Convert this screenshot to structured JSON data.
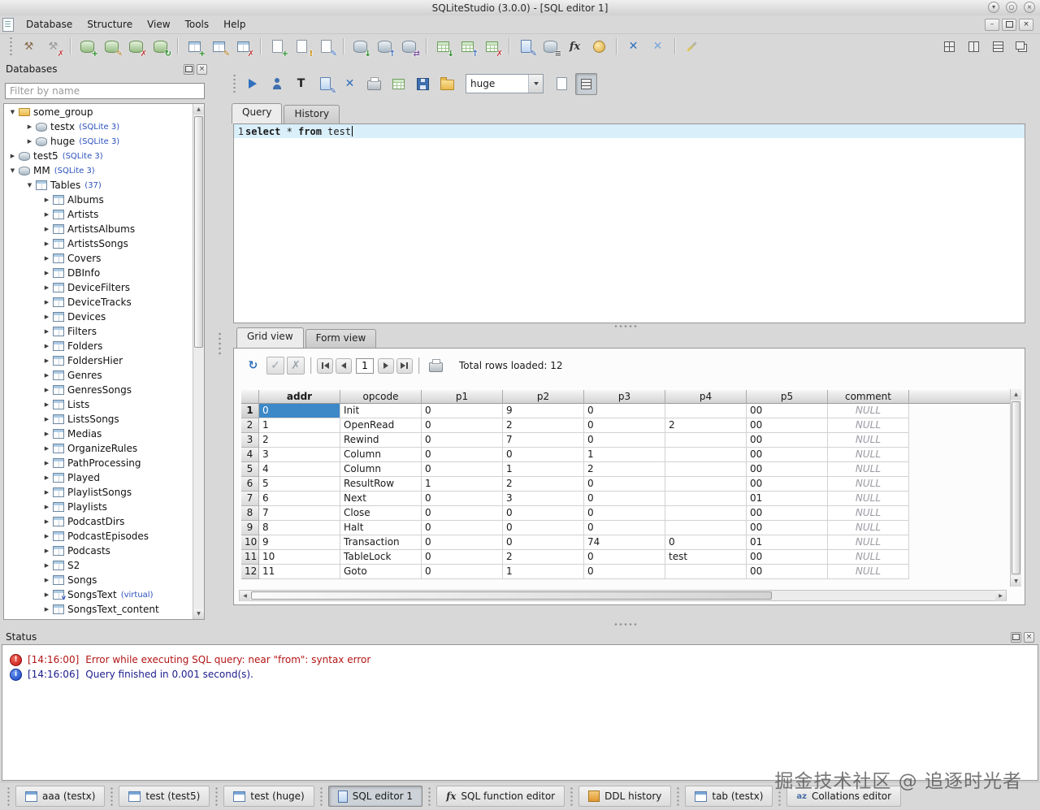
{
  "window": {
    "title": "SQLiteStudio (3.0.0) - [SQL editor 1]"
  },
  "menubar": {
    "items": [
      "Database",
      "Structure",
      "View",
      "Tools",
      "Help"
    ]
  },
  "main_toolbar": [
    {
      "handle": true
    },
    {
      "name": "connect-database-icon",
      "base": "tool",
      "glyph": "⚒",
      "color": "#8a6d4f"
    },
    {
      "name": "disconnect-database-icon",
      "base": "tool",
      "glyph": "⚒",
      "color": "#9a9a9a",
      "badge": "✗",
      "badge_color": "#c23a3a"
    },
    {
      "sep": true
    },
    {
      "name": "add-database-icon",
      "base": "db green",
      "badge": "+",
      "badge_color": "#1f8c1f"
    },
    {
      "name": "edit-database-icon",
      "base": "db green",
      "badge": "✎",
      "badge_color": "#b07818"
    },
    {
      "name": "remove-database-icon",
      "base": "db green",
      "badge": "✗",
      "badge_color": "#c23a3a"
    },
    {
      "name": "refresh-schema-icon",
      "base": "db green",
      "badge": "↻",
      "badge_color": "#1f8c1f"
    },
    {
      "sep": true
    },
    {
      "name": "new-table-icon",
      "base": "tbl",
      "badge": "+",
      "badge_color": "#1f8c1f"
    },
    {
      "name": "edit-table-icon",
      "base": "tbl",
      "badge": "✎",
      "badge_color": "#b07818"
    },
    {
      "name": "drop-table-icon",
      "base": "tbl",
      "badge": "✗",
      "badge_color": "#c23a3a"
    },
    {
      "sep": true
    },
    {
      "name": "new-index-icon",
      "base": "doc",
      "badge": "+",
      "badge_color": "#1f8c1f"
    },
    {
      "name": "new-trigger-icon",
      "base": "doc",
      "badge": "!",
      "badge_color": "#d08a00"
    },
    {
      "name": "new-view-icon",
      "base": "doc",
      "badge": "✎",
      "badge_color": "#3a6fc2"
    },
    {
      "sep": true
    },
    {
      "name": "import-icon",
      "base": "db",
      "badge": "↓",
      "badge_color": "#1f8c1f"
    },
    {
      "name": "export-icon",
      "base": "db",
      "badge": "↑",
      "badge_color": "#3a6fc2"
    },
    {
      "name": "convert-database-icon",
      "base": "db",
      "badge": "⇄",
      "badge_color": "#7a4fa0"
    },
    {
      "sep": true
    },
    {
      "name": "import-table-data-icon",
      "base": "grid-green",
      "badge": "↓",
      "badge_color": "#1f8c1f"
    },
    {
      "name": "export-table-data-icon",
      "base": "grid-green",
      "badge": "↑",
      "badge_color": "#3a6fc2"
    },
    {
      "name": "erase-table-data-icon",
      "base": "grid-green",
      "badge": "✗",
      "badge_color": "#c23a3a"
    },
    {
      "sep": true
    },
    {
      "name": "open-sql-editor-icon",
      "base": "doc blue",
      "badge": "✎",
      "badge_color": "#2f5fae"
    },
    {
      "name": "open-ddl-history-icon",
      "base": "db",
      "badge": "≡",
      "badge_color": "#555555"
    },
    {
      "name": "open-function-editor-icon",
      "base": "fx",
      "glyph": "fx"
    },
    {
      "name": "open-collation-editor-icon",
      "base": "globe"
    },
    {
      "sep": true
    },
    {
      "name": "restore-all-windows-icon",
      "glyph": "✕",
      "color": "#2f6fbe",
      "bold": true
    },
    {
      "name": "close-all-windows-icon",
      "glyph": "✕",
      "color": "#7aa7d8",
      "bold": true
    },
    {
      "sep": true
    },
    {
      "name": "configure-icon",
      "base": "wand"
    },
    {
      "spring": true
    },
    {
      "name": "mdi-tile-icon",
      "base": "mdi-grid"
    },
    {
      "name": "mdi-tile-vertical-icon",
      "base": "mdi-vert"
    },
    {
      "name": "mdi-tile-horizontal-icon",
      "base": "mdi-horiz"
    },
    {
      "name": "mdi-cascade-icon",
      "base": "mdi-casc"
    }
  ],
  "databases_panel": {
    "title": "Databases",
    "filter_placeholder": "Filter by name",
    "tree": [
      {
        "label": "some_group",
        "type": "folder",
        "level": 0,
        "state": "expanded"
      },
      {
        "label": "testx",
        "suffix": "(SQLite 3)",
        "type": "db",
        "level": 1,
        "state": "collapsed"
      },
      {
        "label": "huge",
        "suffix": "(SQLite 3)",
        "type": "db",
        "level": 1,
        "state": "collapsed"
      },
      {
        "label": "test5",
        "suffix": "(SQLite 3)",
        "type": "db",
        "level": 0,
        "state": "collapsed"
      },
      {
        "label": "MM",
        "suffix": "(SQLite 3)",
        "type": "db",
        "level": 0,
        "state": "expanded"
      },
      {
        "label": "Tables",
        "suffix": "(37)",
        "type": "tables",
        "level": 1,
        "state": "expanded"
      },
      {
        "label": "Albums",
        "type": "table",
        "level": 2,
        "state": "collapsed"
      },
      {
        "label": "Artists",
        "type": "table",
        "level": 2,
        "state": "collapsed"
      },
      {
        "label": "ArtistsAlbums",
        "type": "table",
        "level": 2,
        "state": "collapsed"
      },
      {
        "label": "ArtistsSongs",
        "type": "table",
        "level": 2,
        "state": "collapsed"
      },
      {
        "label": "Covers",
        "type": "table",
        "level": 2,
        "state": "collapsed"
      },
      {
        "label": "DBInfo",
        "type": "table",
        "level": 2,
        "state": "collapsed"
      },
      {
        "label": "DeviceFilters",
        "type": "table",
        "level": 2,
        "state": "collapsed"
      },
      {
        "label": "DeviceTracks",
        "type": "table",
        "level": 2,
        "state": "collapsed"
      },
      {
        "label": "Devices",
        "type": "table",
        "level": 2,
        "state": "collapsed"
      },
      {
        "label": "Filters",
        "type": "table",
        "level": 2,
        "state": "collapsed"
      },
      {
        "label": "Folders",
        "type": "table",
        "level": 2,
        "state": "collapsed"
      },
      {
        "label": "FoldersHier",
        "type": "table",
        "level": 2,
        "state": "collapsed"
      },
      {
        "label": "Genres",
        "type": "table",
        "level": 2,
        "state": "collapsed"
      },
      {
        "label": "GenresSongs",
        "type": "table",
        "level": 2,
        "state": "collapsed"
      },
      {
        "label": "Lists",
        "type": "table",
        "level": 2,
        "state": "collapsed"
      },
      {
        "label": "ListsSongs",
        "type": "table",
        "level": 2,
        "state": "collapsed"
      },
      {
        "label": "Medias",
        "type": "table",
        "level": 2,
        "state": "collapsed"
      },
      {
        "label": "OrganizeRules",
        "type": "table",
        "level": 2,
        "state": "collapsed"
      },
      {
        "label": "PathProcessing",
        "type": "table",
        "level": 2,
        "state": "collapsed"
      },
      {
        "label": "Played",
        "type": "table",
        "level": 2,
        "state": "collapsed"
      },
      {
        "label": "PlaylistSongs",
        "type": "table",
        "level": 2,
        "state": "collapsed"
      },
      {
        "label": "Playlists",
        "type": "table",
        "level": 2,
        "state": "collapsed"
      },
      {
        "label": "PodcastDirs",
        "type": "table",
        "level": 2,
        "state": "collapsed"
      },
      {
        "label": "PodcastEpisodes",
        "type": "table",
        "level": 2,
        "state": "collapsed"
      },
      {
        "label": "Podcasts",
        "type": "table",
        "level": 2,
        "state": "collapsed"
      },
      {
        "label": "S2",
        "type": "table",
        "level": 2,
        "state": "collapsed"
      },
      {
        "label": "Songs",
        "type": "table",
        "level": 2,
        "state": "collapsed"
      },
      {
        "label": "SongsText",
        "suffix": "(virtual)",
        "type": "table-virtual",
        "level": 2,
        "state": "collapsed"
      },
      {
        "label": "SongsText_content",
        "type": "table",
        "level": 2,
        "state": "collapsed"
      }
    ]
  },
  "sql_editor": {
    "toolbar": [
      {
        "handle": true
      },
      {
        "name": "execute-query-icon",
        "base": "play"
      },
      {
        "name": "explain-query-icon",
        "base": "person"
      },
      {
        "name": "format-sql-icon",
        "glyph": "T",
        "color": "#222222",
        "bold": true
      },
      {
        "name": "create-view-from-query-icon",
        "base": "doc blue",
        "badge": "✎",
        "badge_color": "#2f5fae"
      },
      {
        "name": "export-results-icon",
        "glyph": "✕",
        "color": "#2f6fbe",
        "bold": true
      },
      {
        "name": "print-icon",
        "base": "printer"
      },
      {
        "name": "export-csv-icon",
        "base": "grid-green"
      },
      {
        "name": "save-sql-icon",
        "base": "floppy"
      },
      {
        "name": "load-sql-icon",
        "base": "folder"
      },
      {
        "combo": true,
        "name": "database-combo"
      },
      {
        "name": "new-query-icon",
        "base": "doc"
      },
      {
        "name": "results-layout-toggle",
        "base": "mdi-horiz",
        "pressed": true
      }
    ],
    "database_combo": "huge",
    "tabs": [
      {
        "label": "Query",
        "active": true
      },
      {
        "label": "History",
        "active": false
      }
    ],
    "line_number": "1",
    "tokens": [
      {
        "text": "select",
        "keyword": true
      },
      {
        "text": " * ",
        "keyword": false
      },
      {
        "text": "from",
        "keyword": true
      },
      {
        "text": " test",
        "keyword": false
      }
    ]
  },
  "results": {
    "tabs": [
      {
        "label": "Grid view",
        "active": true
      },
      {
        "label": "Form view",
        "active": false
      }
    ],
    "toolbar": [
      {
        "name": "refresh-results-icon",
        "glyph": "↻",
        "color": "#2f6fbe",
        "bold": true
      },
      {
        "name": "commit-icon",
        "glyph": "✓",
        "color": "#9aa5ad",
        "framed": true
      },
      {
        "name": "rollback-icon",
        "glyph": "✗",
        "color": "#9aa5ad",
        "framed": true
      },
      {
        "sep": true
      },
      {
        "name": "first-page-icon",
        "nav": "first"
      },
      {
        "name": "prev-page-icon",
        "nav": "prev"
      },
      {
        "input": true,
        "name": "page-input"
      },
      {
        "name": "next-page-icon",
        "nav": "next"
      },
      {
        "name": "last-page-icon",
        "nav": "last"
      },
      {
        "sep": true
      },
      {
        "name": "filter-results-icon",
        "base": "printer"
      },
      {
        "label": true,
        "name": "total-rows-label"
      }
    ],
    "page_value": "1",
    "total_rows_label": "Total rows loaded: 12",
    "columns": [
      "addr",
      "opcode",
      "p1",
      "p2",
      "p3",
      "p4",
      "p5",
      "comment"
    ],
    "sorted_column": "addr",
    "rows": [
      {
        "num": "1",
        "cells": [
          "0",
          "Init",
          "0",
          "9",
          "0",
          "",
          "00"
        ],
        "comment": "NULL"
      },
      {
        "num": "2",
        "cells": [
          "1",
          "OpenRead",
          "0",
          "2",
          "0",
          "2",
          "00"
        ],
        "comment": "NULL"
      },
      {
        "num": "3",
        "cells": [
          "2",
          "Rewind",
          "0",
          "7",
          "0",
          "",
          "00"
        ],
        "comment": "NULL"
      },
      {
        "num": "4",
        "cells": [
          "3",
          "Column",
          "0",
          "0",
          "1",
          "",
          "00"
        ],
        "comment": "NULL"
      },
      {
        "num": "5",
        "cells": [
          "4",
          "Column",
          "0",
          "1",
          "2",
          "",
          "00"
        ],
        "comment": "NULL"
      },
      {
        "num": "6",
        "cells": [
          "5",
          "ResultRow",
          "1",
          "2",
          "0",
          "",
          "00"
        ],
        "comment": "NULL"
      },
      {
        "num": "7",
        "cells": [
          "6",
          "Next",
          "0",
          "3",
          "0",
          "",
          "01"
        ],
        "comment": "NULL"
      },
      {
        "num": "8",
        "cells": [
          "7",
          "Close",
          "0",
          "0",
          "0",
          "",
          "00"
        ],
        "comment": "NULL"
      },
      {
        "num": "9",
        "cells": [
          "8",
          "Halt",
          "0",
          "0",
          "0",
          "",
          "00"
        ],
        "comment": "NULL"
      },
      {
        "num": "10",
        "cells": [
          "9",
          "Transaction",
          "0",
          "0",
          "74",
          "0",
          "01"
        ],
        "comment": "NULL"
      },
      {
        "num": "11",
        "cells": [
          "10",
          "TableLock",
          "0",
          "2",
          "0",
          "test",
          "00"
        ],
        "comment": "NULL"
      },
      {
        "num": "12",
        "cells": [
          "11",
          "Goto",
          "0",
          "1",
          "0",
          "",
          "00"
        ],
        "comment": "NULL"
      }
    ]
  },
  "status_panel": {
    "title": "Status",
    "messages": [
      {
        "type": "error",
        "time": "[14:16:00]",
        "text": "Error while executing SQL query: near \"from\": syntax error"
      },
      {
        "type": "info",
        "time": "[14:16:06]",
        "text": "Query finished in 0.001 second(s)."
      }
    ]
  },
  "taskbar": {
    "buttons": [
      {
        "label": "aaa (testx)",
        "icon": "window",
        "active": false
      },
      {
        "label": "test (test5)",
        "icon": "window",
        "active": false
      },
      {
        "label": "test (huge)",
        "icon": "window",
        "active": false
      },
      {
        "label": "SQL editor 1",
        "icon": "sql-editor",
        "active": true
      },
      {
        "label": "SQL function editor",
        "icon": "function",
        "active": false
      },
      {
        "label": "DDL history",
        "icon": "ddl",
        "active": false
      },
      {
        "label": "tab (testx)",
        "icon": "window",
        "active": false
      },
      {
        "label": "Collations editor",
        "icon": "collation",
        "active": false
      }
    ]
  },
  "watermark": "掘金技术社区 @ 追逐时光者"
}
